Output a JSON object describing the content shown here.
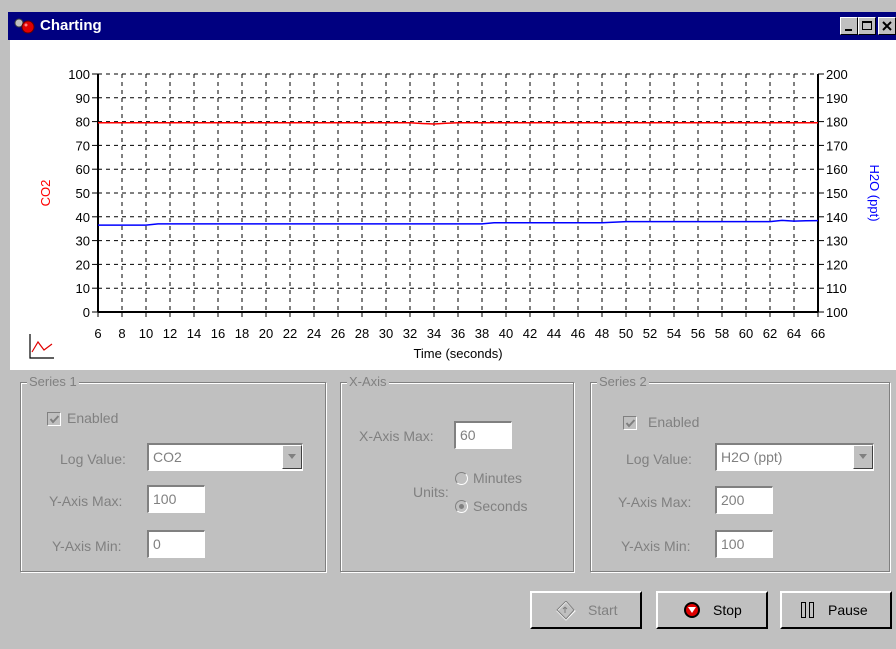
{
  "window": {
    "title": "Charting",
    "controls": [
      "minimize-icon",
      "maximize-icon",
      "close-icon"
    ]
  },
  "chart_data": {
    "type": "line",
    "xlabel": "Time (seconds)",
    "y1label": "CO2",
    "y2label": "H2O (ppt)",
    "xlim": [
      6,
      66
    ],
    "y1lim": [
      0,
      100
    ],
    "y2lim": [
      100,
      200
    ],
    "x_ticks": [
      6,
      8,
      10,
      12,
      14,
      16,
      18,
      20,
      22,
      24,
      26,
      28,
      30,
      32,
      34,
      36,
      38,
      40,
      42,
      44,
      46,
      48,
      50,
      52,
      54,
      56,
      58,
      60,
      62,
      64,
      66
    ],
    "y1_ticks": [
      0,
      10,
      20,
      30,
      40,
      50,
      60,
      70,
      80,
      90,
      100
    ],
    "y2_ticks": [
      100,
      110,
      120,
      130,
      140,
      150,
      160,
      170,
      180,
      190,
      200
    ],
    "grid": true,
    "colors": {
      "co2": "#ff0000",
      "h2o": "#0000ff",
      "y1axis": "#ff0000",
      "y2axis": "#0000ff"
    },
    "series": [
      {
        "name": "CO2",
        "axis": "left",
        "color": "#ff0000",
        "x": [
          6,
          32,
          33,
          34,
          35,
          36,
          66
        ],
        "y": [
          79.5,
          79.5,
          79.2,
          79.0,
          79.3,
          79.5,
          79.5
        ]
      },
      {
        "name": "H2O (ppt)",
        "axis": "right",
        "color": "#0000ff",
        "x": [
          6,
          10,
          11,
          20,
          30,
          38,
          39,
          48,
          50,
          58,
          62,
          63,
          64,
          65,
          66
        ],
        "y": [
          136.5,
          136.5,
          137.0,
          137.0,
          137.0,
          137.0,
          137.5,
          137.5,
          138.0,
          138.0,
          138.0,
          138.5,
          138.2,
          138.3,
          138.4
        ]
      }
    ]
  },
  "series1": {
    "legend": "Series 1",
    "enabled_label": "Enabled",
    "enabled": true,
    "log_value_label": "Log Value:",
    "log_value": "CO2",
    "ymax_label": "Y-Axis Max:",
    "ymax": "100",
    "ymin_label": "Y-Axis Min:",
    "ymin": "0"
  },
  "xaxis": {
    "legend": "X-Axis",
    "xmax_label": "X-Axis Max:",
    "xmax": "60",
    "units_label": "Units:",
    "units_options": [
      "Minutes",
      "Seconds"
    ],
    "units_selected": "Seconds"
  },
  "series2": {
    "legend": "Series 2",
    "enabled_label": "Enabled",
    "enabled": true,
    "log_value_label": "Log Value:",
    "log_value": "H2O (ppt)",
    "ymax_label": "Y-Axis Max:",
    "ymax": "200",
    "ymin_label": "Y-Axis Min:",
    "ymin": "100"
  },
  "buttons": {
    "start": "Start",
    "stop": "Stop",
    "pause": "Pause"
  }
}
